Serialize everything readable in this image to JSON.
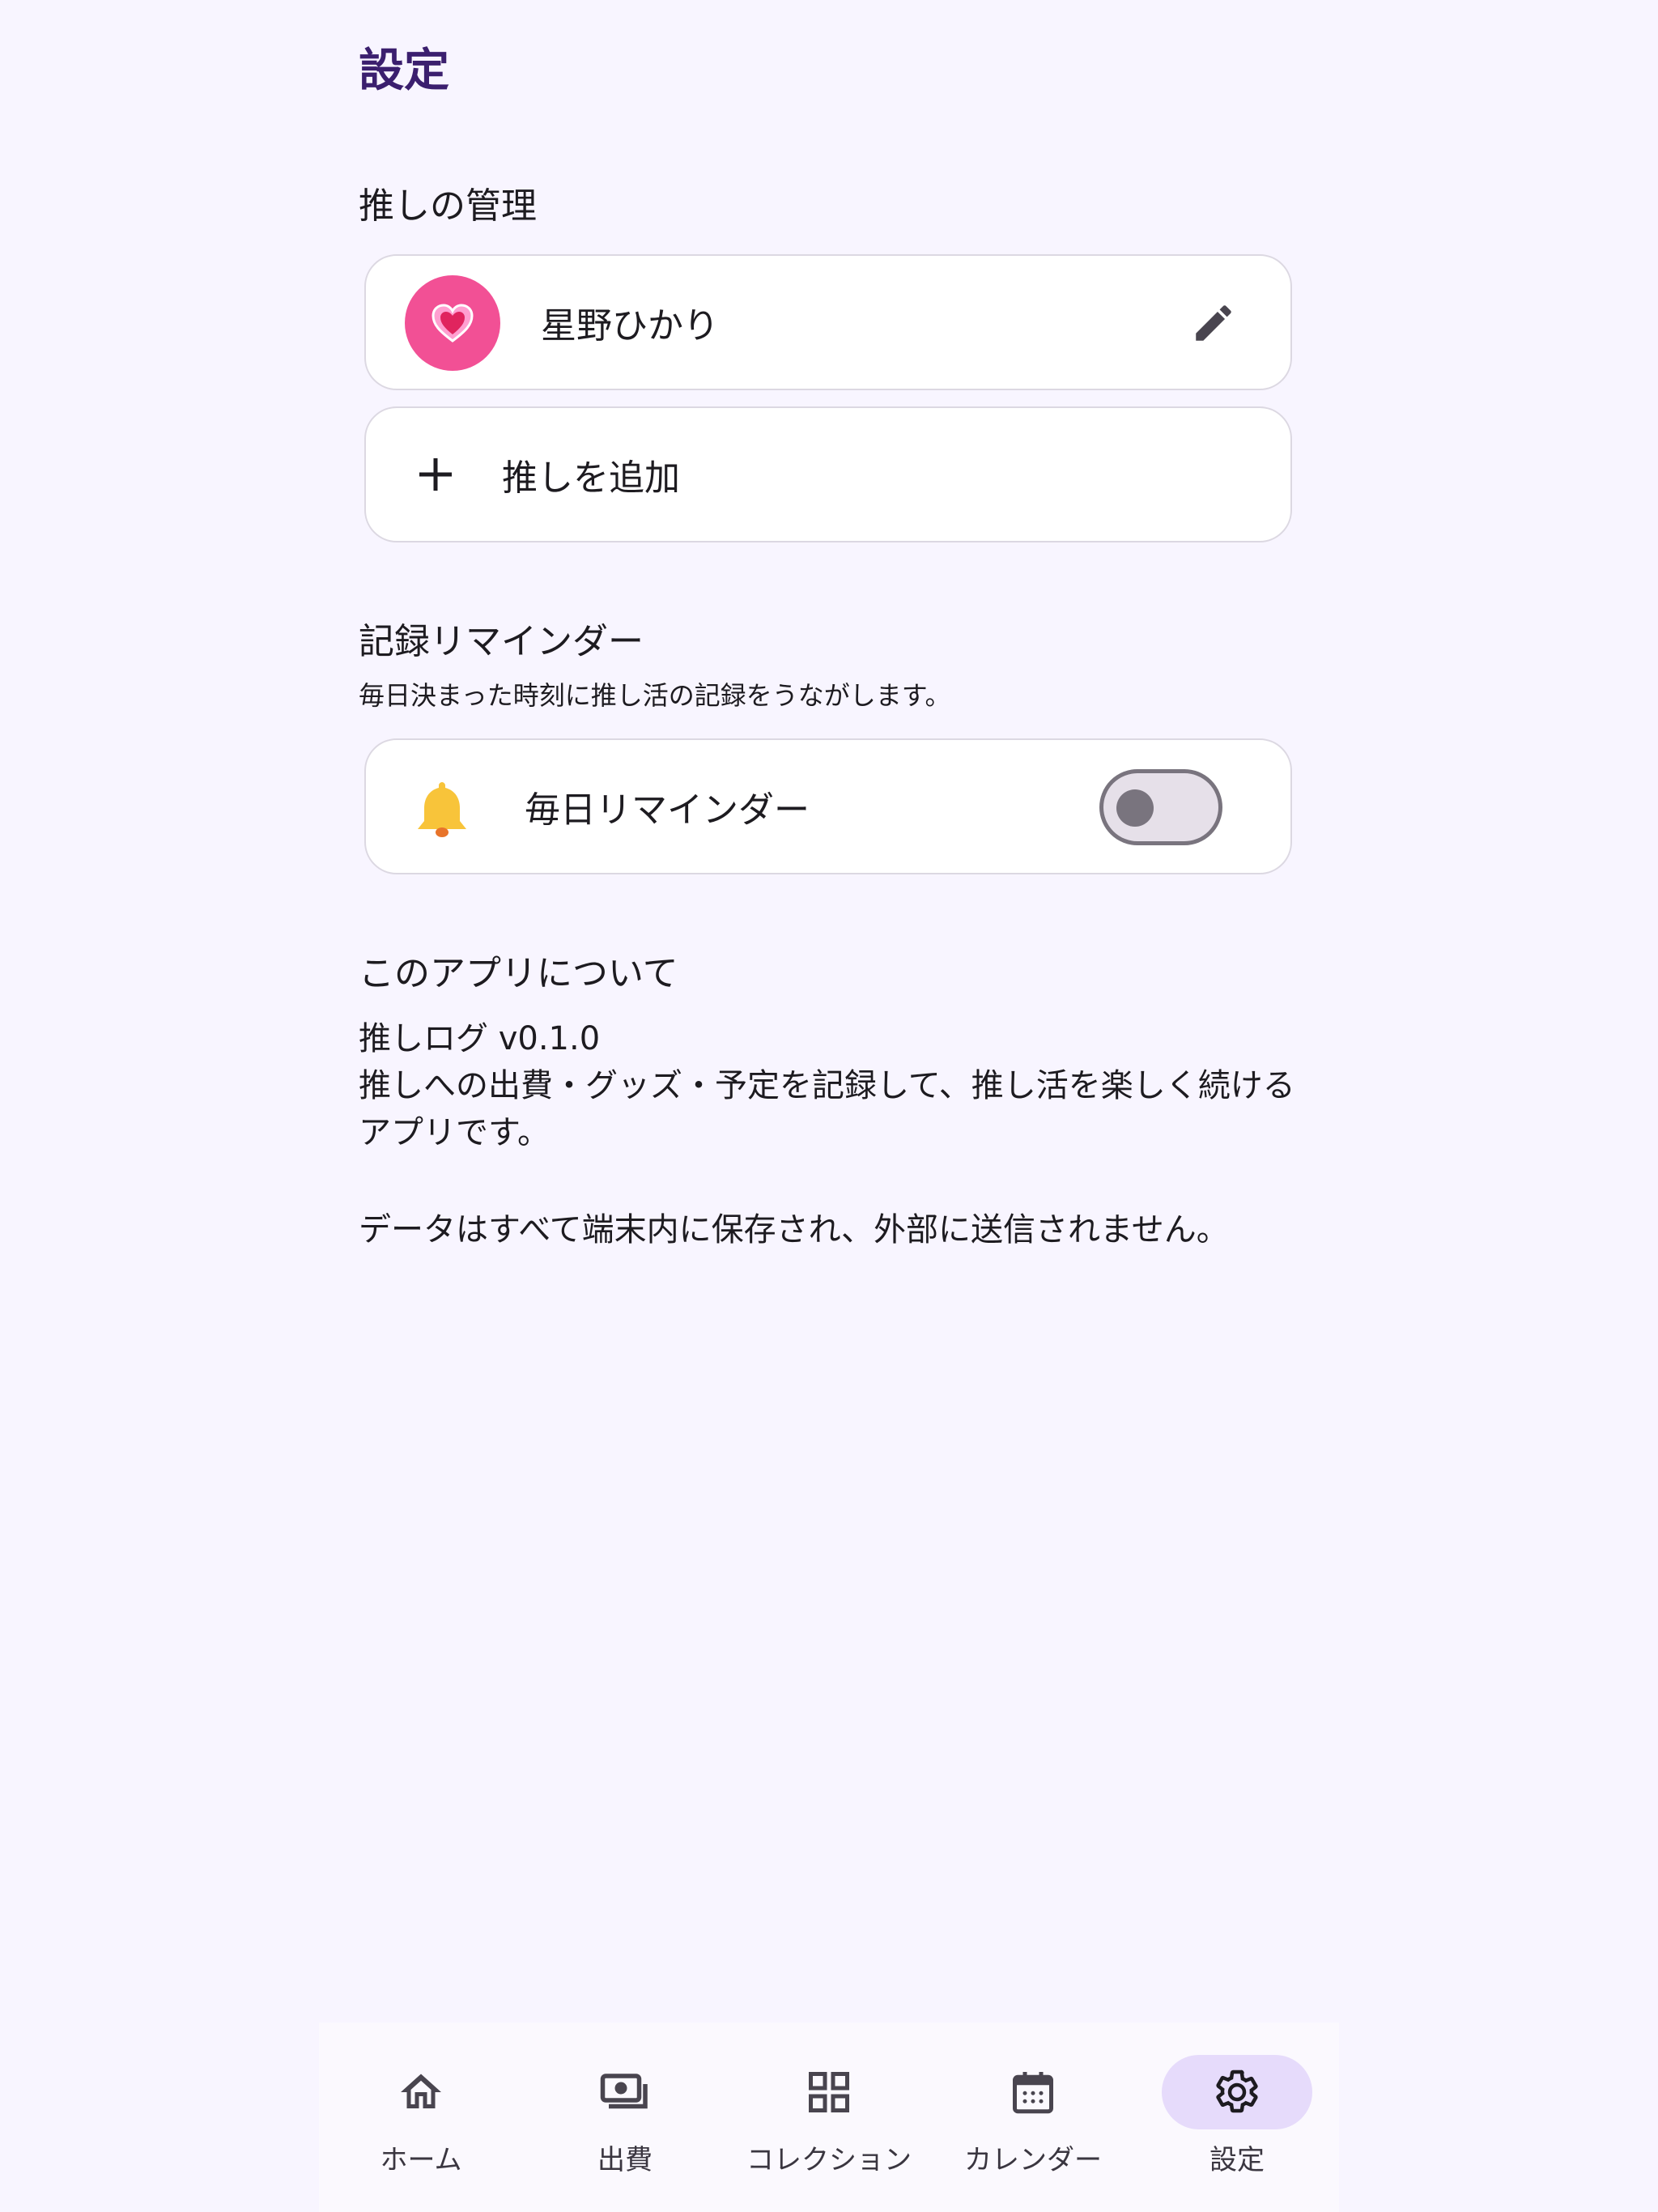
{
  "page": {
    "title": "設定"
  },
  "oshi_section": {
    "label": "推しの管理",
    "items": [
      {
        "name": "星野ひかり",
        "avatar_icon": "heart-icon",
        "avatar_color": "#f25095"
      }
    ],
    "add_label": "推しを追加"
  },
  "reminder_section": {
    "label": "記録リマインダー",
    "description": "毎日決まった時刻に推し活の記録をうながします。",
    "toggle_label": "毎日リマインダー",
    "toggle_on": false
  },
  "about_section": {
    "label": "このアプリについて",
    "version": "推しログ v0.1.0",
    "description": "推しへの出費・グッズ・予定を記録して、推し活を楽しく続けるアプリです。",
    "privacy": "データはすべて端末内に保存され、外部に送信されません。"
  },
  "bottom_nav": {
    "items": [
      {
        "label": "ホーム",
        "icon": "home-icon"
      },
      {
        "label": "出費",
        "icon": "payments-icon"
      },
      {
        "label": "コレクション",
        "icon": "grid-icon"
      },
      {
        "label": "カレンダー",
        "icon": "calendar-icon"
      },
      {
        "label": "設定",
        "icon": "gear-icon",
        "active": true
      }
    ]
  },
  "colors": {
    "accent": "#3b1f6e",
    "background": "#f8f5ff",
    "active_pill": "#e6dbfb",
    "avatar": "#f25095"
  }
}
